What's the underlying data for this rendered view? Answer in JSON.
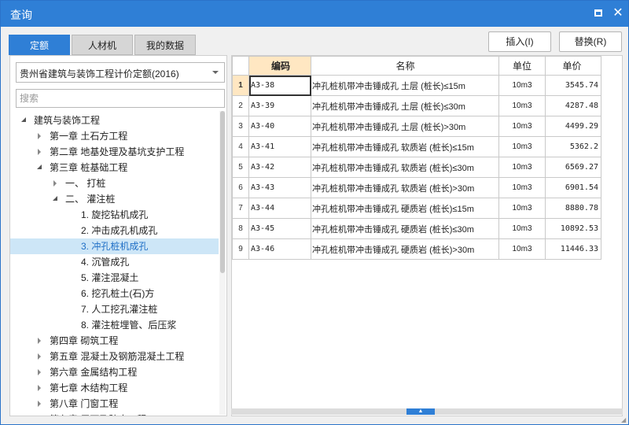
{
  "window": {
    "title": "查询",
    "close_glyph": "✕"
  },
  "tabs": [
    {
      "label": "定额",
      "active": true
    },
    {
      "label": "人材机",
      "active": false
    },
    {
      "label": "我的数据",
      "active": false
    }
  ],
  "actions": {
    "insert": "插入(I)",
    "replace": "替换(R)"
  },
  "left": {
    "select_value": "贵州省建筑与装饰工程计价定额(2016)",
    "search_placeholder": "搜索",
    "tree": [
      {
        "label": "建筑与装饰工程",
        "level": 0,
        "state": "expanded"
      },
      {
        "label": "第一章 土石方工程",
        "level": 1,
        "state": "collapsed"
      },
      {
        "label": "第二章 地基处理及基坑支护工程",
        "level": 1,
        "state": "collapsed"
      },
      {
        "label": "第三章 桩基础工程",
        "level": 1,
        "state": "expanded"
      },
      {
        "label": "一、 打桩",
        "level": 2,
        "state": "collapsed"
      },
      {
        "label": "二、 灌注桩",
        "level": 2,
        "state": "expanded"
      },
      {
        "label": "1. 旋挖钻机成孔",
        "level": 3,
        "state": "leaf"
      },
      {
        "label": "2. 冲击成孔机成孔",
        "level": 3,
        "state": "leaf"
      },
      {
        "label": "3. 冲孔桩机成孔",
        "level": 3,
        "state": "leaf",
        "selected": true
      },
      {
        "label": "4. 沉管成孔",
        "level": 3,
        "state": "leaf"
      },
      {
        "label": "5. 灌注混凝土",
        "level": 3,
        "state": "leaf"
      },
      {
        "label": "6. 挖孔桩土(石)方",
        "level": 3,
        "state": "leaf"
      },
      {
        "label": "7. 人工挖孔灌注桩",
        "level": 3,
        "state": "leaf"
      },
      {
        "label": "8. 灌注桩埋管、后压浆",
        "level": 3,
        "state": "leaf"
      },
      {
        "label": "第四章 砌筑工程",
        "level": 1,
        "state": "collapsed"
      },
      {
        "label": "第五章 混凝土及钢筋混凝土工程",
        "level": 1,
        "state": "collapsed"
      },
      {
        "label": "第六章 金属结构工程",
        "level": 1,
        "state": "collapsed"
      },
      {
        "label": "第七章 木结构工程",
        "level": 1,
        "state": "collapsed"
      },
      {
        "label": "第八章 门窗工程",
        "level": 1,
        "state": "collapsed"
      },
      {
        "label": "第九章 屋面及防水工程",
        "level": 1,
        "state": "collapsed"
      }
    ]
  },
  "grid": {
    "headers": [
      "编码",
      "名称",
      "单位",
      "单价"
    ],
    "rows": [
      {
        "idx": "1",
        "code": "A3-38",
        "name": "冲孔桩机带冲击锤成孔 土层 (桩长)≤15m",
        "unit": "10m3",
        "price": "3545.74"
      },
      {
        "idx": "2",
        "code": "A3-39",
        "name": "冲孔桩机带冲击锤成孔 土层 (桩长)≤30m",
        "unit": "10m3",
        "price": "4287.48"
      },
      {
        "idx": "3",
        "code": "A3-40",
        "name": "冲孔桩机带冲击锤成孔 土层 (桩长)>30m",
        "unit": "10m3",
        "price": "4499.29"
      },
      {
        "idx": "4",
        "code": "A3-41",
        "name": "冲孔桩机带冲击锤成孔 软质岩 (桩长)≤15m",
        "unit": "10m3",
        "price": "5362.2"
      },
      {
        "idx": "5",
        "code": "A3-42",
        "name": "冲孔桩机带冲击锤成孔 软质岩 (桩长)≤30m",
        "unit": "10m3",
        "price": "6569.27"
      },
      {
        "idx": "6",
        "code": "A3-43",
        "name": "冲孔桩机带冲击锤成孔 软质岩 (桩长)>30m",
        "unit": "10m3",
        "price": "6901.54"
      },
      {
        "idx": "7",
        "code": "A3-44",
        "name": "冲孔桩机带冲击锤成孔 硬质岩 (桩长)≤15m",
        "unit": "10m3",
        "price": "8880.78"
      },
      {
        "idx": "8",
        "code": "A3-45",
        "name": "冲孔桩机带冲击锤成孔 硬质岩 (桩长)≤30m",
        "unit": "10m3",
        "price": "10892.53"
      },
      {
        "idx": "9",
        "code": "A3-46",
        "name": "冲孔桩机带冲击锤成孔 硬质岩 (桩长)>30m",
        "unit": "10m3",
        "price": "11446.33"
      }
    ]
  },
  "colors": {
    "accent": "#2f7fd6",
    "selected_bg": "#cde6f7",
    "header_highlight": "#ffe7c2"
  },
  "icons": {
    "maximize": "maximize-icon",
    "close": "close-icon",
    "dropdown": "chevron-down-icon",
    "splitter": "collapse-up-icon"
  }
}
